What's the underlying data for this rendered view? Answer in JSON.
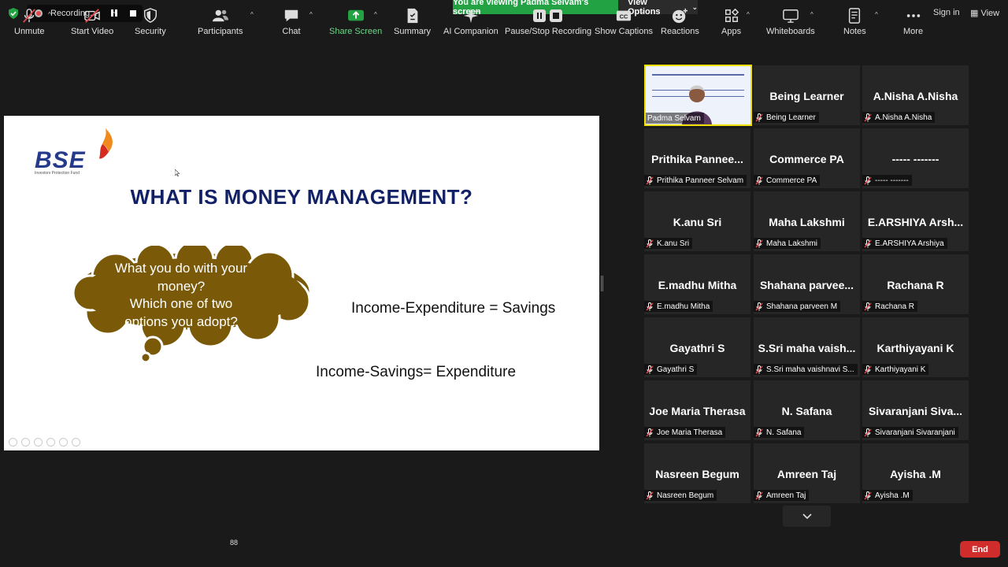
{
  "recording": {
    "label": "Recording..."
  },
  "banner": {
    "viewing": "You are viewing Padma Selvam's screen",
    "view_options": "View Options"
  },
  "top_right": {
    "sign_in": "Sign in",
    "view": "View"
  },
  "slide": {
    "logo_text": "BSE",
    "logo_subtext": "Investors Protection Fund",
    "title": "WHAT IS MONEY MANAGEMENT?",
    "cloud_lines": [
      "What you do with your",
      "money?",
      "Which one of two",
      "options you adopt?"
    ],
    "equation_1": "Income-Expenditure = Savings",
    "equation_2": "Income-Savings= Expenditure"
  },
  "presenter": {
    "name": "Padma Selvam"
  },
  "participants_tiles": [
    {
      "display": "Being Learner",
      "label": "Being Learner"
    },
    {
      "display": "A.Nisha A.Nisha",
      "label": "A.Nisha A.Nisha"
    },
    {
      "display": "Prithika Pannee...",
      "label": "Prithika Panneer Selvam"
    },
    {
      "display": "Commerce PA",
      "label": "Commerce PA"
    },
    {
      "display": "----- -------",
      "label": "----- -------"
    },
    {
      "display": "K.anu Sri",
      "label": "K.anu Sri"
    },
    {
      "display": "Maha Lakshmi",
      "label": "Maha Lakshmi"
    },
    {
      "display": "E.ARSHIYA Arsh...",
      "label": "E.ARSHIYA Arshiya"
    },
    {
      "display": "E.madhu Mitha",
      "label": "E.madhu Mitha"
    },
    {
      "display": "Shahana parvee...",
      "label": "Shahana parveen M"
    },
    {
      "display": "Rachana R",
      "label": "Rachana R"
    },
    {
      "display": "Gayathri S",
      "label": "Gayathri S"
    },
    {
      "display": "S.Sri maha vaish...",
      "label": "S.Sri maha vaishnavi S..."
    },
    {
      "display": "Karthiyayani K",
      "label": "Karthiyayani K"
    },
    {
      "display": "Joe Maria Therasa",
      "label": "Joe Maria Therasa"
    },
    {
      "display": "N. Safana",
      "label": "N. Safana"
    },
    {
      "display": "Sivaranjani Siva...",
      "label": "Sivaranjani Sivaranjani"
    },
    {
      "display": "Nasreen Begum",
      "label": "Nasreen Begum"
    },
    {
      "display": "Amreen Taj",
      "label": "Amreen Taj"
    },
    {
      "display": "Ayisha .M",
      "label": "Ayisha .M"
    }
  ],
  "toolbar": {
    "unmute": "Unmute",
    "start_video": "Start Video",
    "security": "Security",
    "participants": "Participants",
    "participants_count": "88",
    "chat": "Chat",
    "share_screen": "Share Screen",
    "summary": "Summary",
    "ai_companion": "AI Companion",
    "pause_stop_recording": "Pause/Stop Recording",
    "show_captions": "Show Captions",
    "reactions": "Reactions",
    "apps": "Apps",
    "whiteboards": "Whiteboards",
    "notes": "Notes",
    "more": "More",
    "end": "End"
  },
  "colors": {
    "share_green": "#23a244",
    "end_red": "#d12c2c",
    "active_speaker": "#f0e000",
    "slide_title": "#122066",
    "cloud_fill": "#7a5a08"
  }
}
